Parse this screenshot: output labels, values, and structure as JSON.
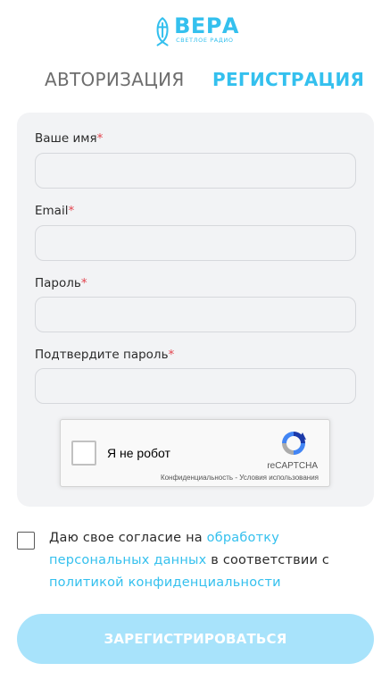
{
  "brand": {
    "name": "ВЕРА",
    "tagline": "СВЕТЛОЕ РАДИО",
    "color": "#34c0ee",
    "icon": "fish-cross-icon"
  },
  "tabs": {
    "login": "АВТОРИЗАЦИЯ",
    "register": "РЕГИСТРАЦИЯ",
    "active": "register"
  },
  "form": {
    "fields": [
      {
        "label": "Ваше имя",
        "required_mark": "*",
        "value": "",
        "type": "text"
      },
      {
        "label": "Email",
        "required_mark": "*",
        "value": "",
        "type": "email"
      },
      {
        "label": "Пароль",
        "required_mark": "*",
        "value": "",
        "type": "password"
      },
      {
        "label": "Подтвердите пароль",
        "required_mark": "*",
        "value": "",
        "type": "password"
      }
    ]
  },
  "recaptcha": {
    "label": "Я не робот",
    "brand": "reCAPTCHA",
    "privacy": "Конфиденциальность",
    "separator": " - ",
    "terms": "Условия использования"
  },
  "consent": {
    "text_before": "Даю свое согласие на ",
    "link1": "обработку персональных данных",
    "text_middle": " в соответствии с ",
    "link2": "политикой конфиденциальности",
    "checked": false
  },
  "submit": {
    "label": "ЗАРЕГИСТРИРОВАТЬСЯ",
    "disabled_color": "#a8e3fb"
  }
}
